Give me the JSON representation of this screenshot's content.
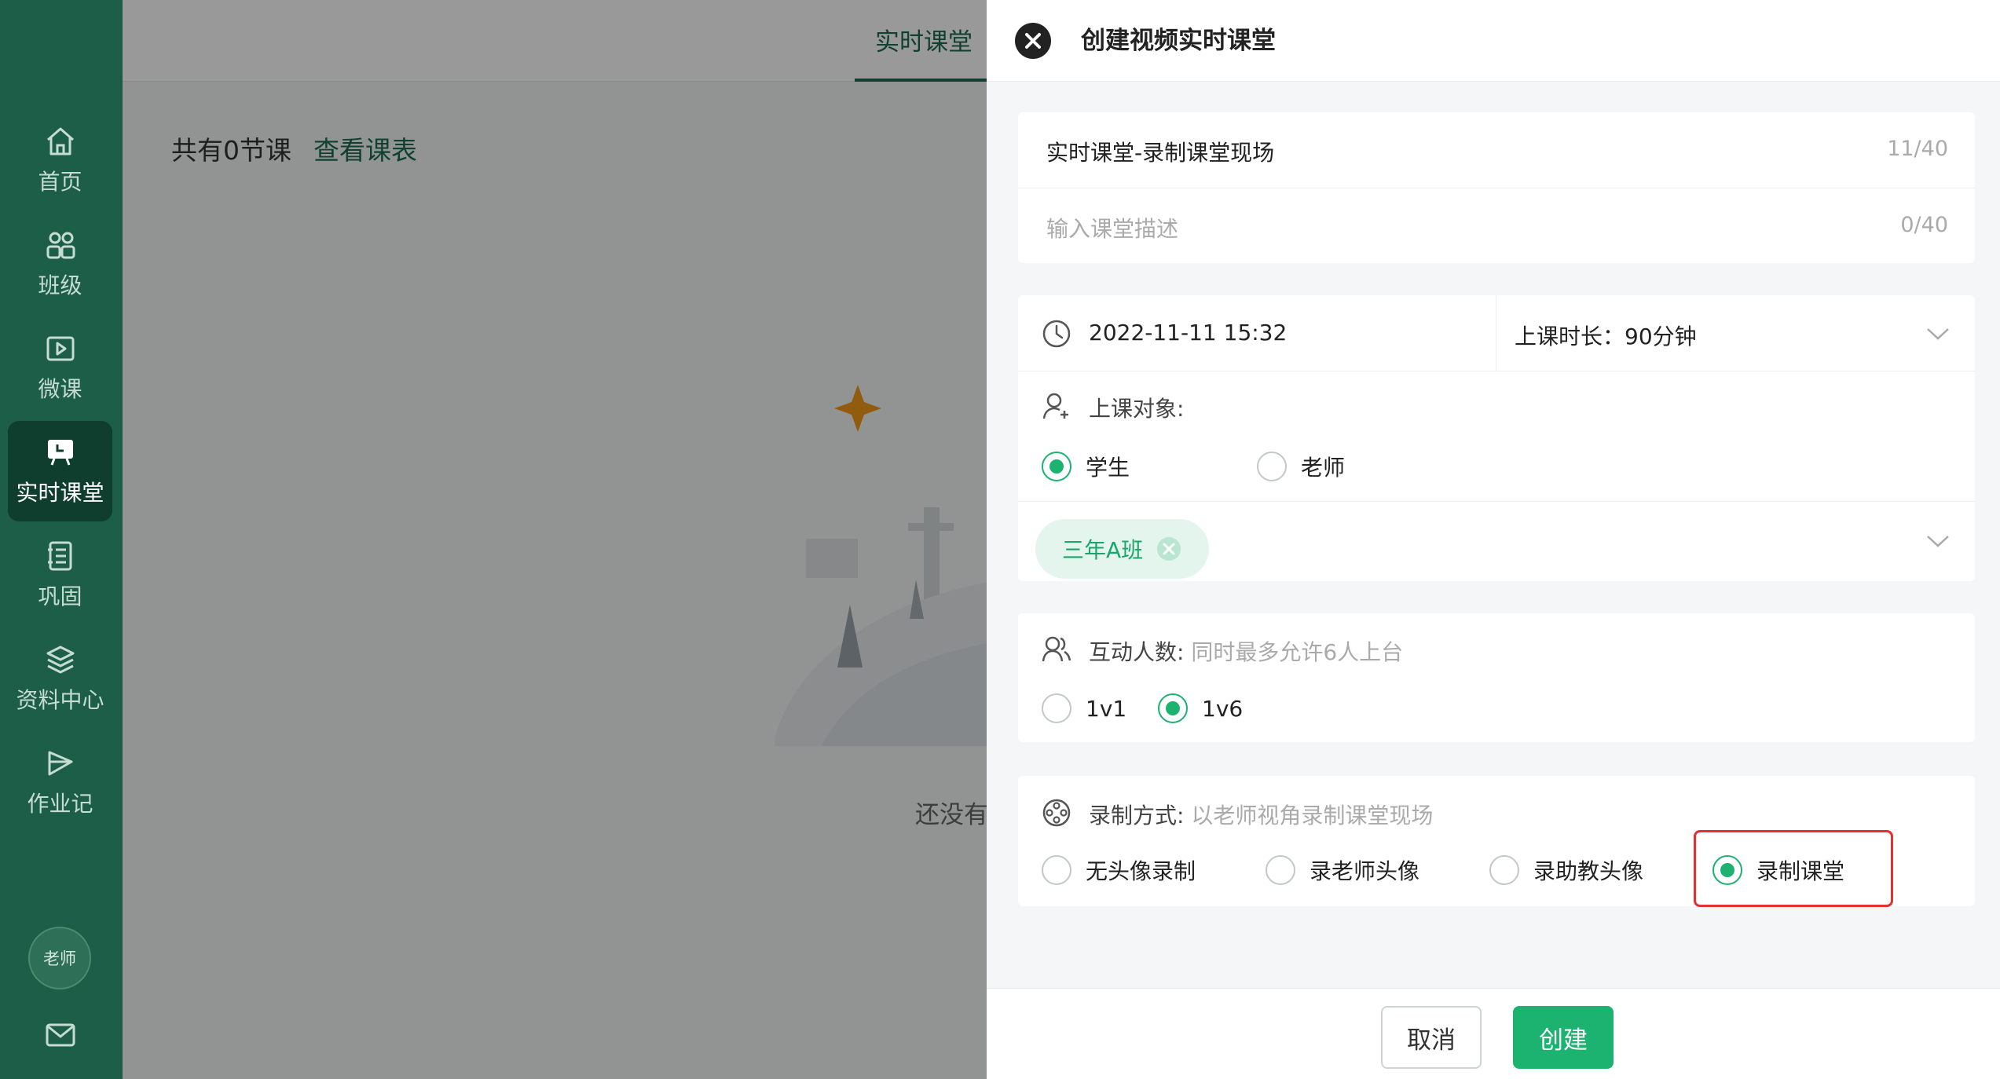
{
  "sidebar": {
    "items": [
      {
        "label": "首页",
        "icon": "home-icon"
      },
      {
        "label": "班级",
        "icon": "users-icon"
      },
      {
        "label": "微课",
        "icon": "video-icon"
      },
      {
        "label": "实时课堂",
        "icon": "live-class-icon"
      },
      {
        "label": "巩固",
        "icon": "notebook-icon"
      },
      {
        "label": "资料中心",
        "icon": "layers-icon"
      },
      {
        "label": "作业记",
        "icon": "homework-icon"
      }
    ],
    "active_index": 3,
    "avatar_label": "老师"
  },
  "main": {
    "tab_label": "实时课堂",
    "summary_text": "共有0节课",
    "view_schedule_link": "查看课表",
    "empty_text": "还没有"
  },
  "drawer": {
    "title": "创建视频实时课堂",
    "title_field": {
      "value": "实时课堂-录制课堂现场",
      "counter": "11/40"
    },
    "desc_field": {
      "placeholder": "输入课堂描述",
      "counter": "0/40"
    },
    "datetime": "2022-11-11 15:32",
    "duration_label": "上课时长：",
    "duration_value": "90分钟",
    "audience": {
      "label": "上课对象:",
      "options": [
        "学生",
        "老师"
      ],
      "selected": "学生",
      "class_tag": "三年A班"
    },
    "interaction": {
      "label": "互动人数:",
      "hint": "同时最多允许6人上台",
      "options": [
        "1v1",
        "1v6"
      ],
      "selected": "1v6"
    },
    "recording": {
      "label": "录制方式:",
      "hint": "以老师视角录制课堂现场",
      "options": [
        "无头像录制",
        "录老师头像",
        "录助教头像",
        "录制课堂"
      ],
      "selected": "录制课堂"
    },
    "cancel_label": "取消",
    "create_label": "创建"
  },
  "colors": {
    "sidebar_bg": "#1c5e48",
    "accent_green": "#1bb36f",
    "highlight_red": "#e53030"
  }
}
